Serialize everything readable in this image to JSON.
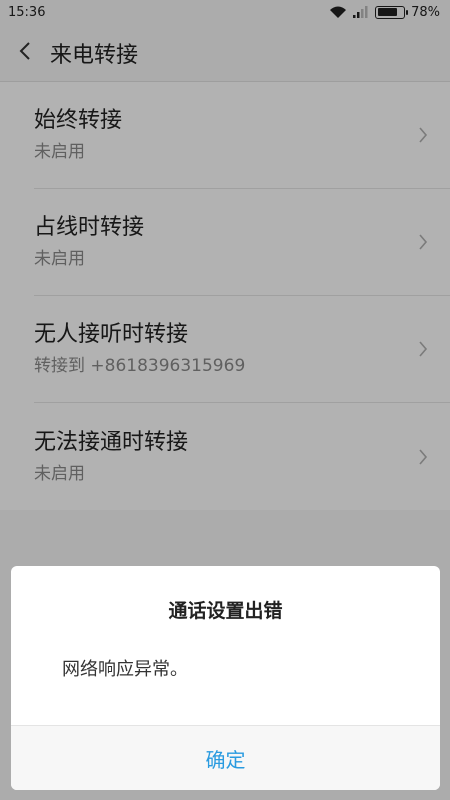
{
  "status_bar": {
    "time": "15:36",
    "battery_percent": "78%",
    "battery_level": 0.78,
    "icons": [
      "wifi-icon",
      "signal-icon",
      "battery-icon"
    ]
  },
  "header": {
    "title": "来电转接",
    "back_icon": "chevron-left-icon"
  },
  "list": {
    "items": [
      {
        "title": "始终转接",
        "subtitle": "未启用"
      },
      {
        "title": "占线时转接",
        "subtitle": "未启用"
      },
      {
        "title": "无人接听时转接",
        "subtitle": "转接到 +8618396315969"
      },
      {
        "title": "无法接通时转接",
        "subtitle": "未启用"
      }
    ]
  },
  "dialog": {
    "title": "通话设置出错",
    "message": "网络响应异常。",
    "confirm_label": "确定"
  },
  "colors": {
    "accent": "#2a9be0",
    "background": "#f7f7f7",
    "subtitle": "#8a8a8a"
  }
}
